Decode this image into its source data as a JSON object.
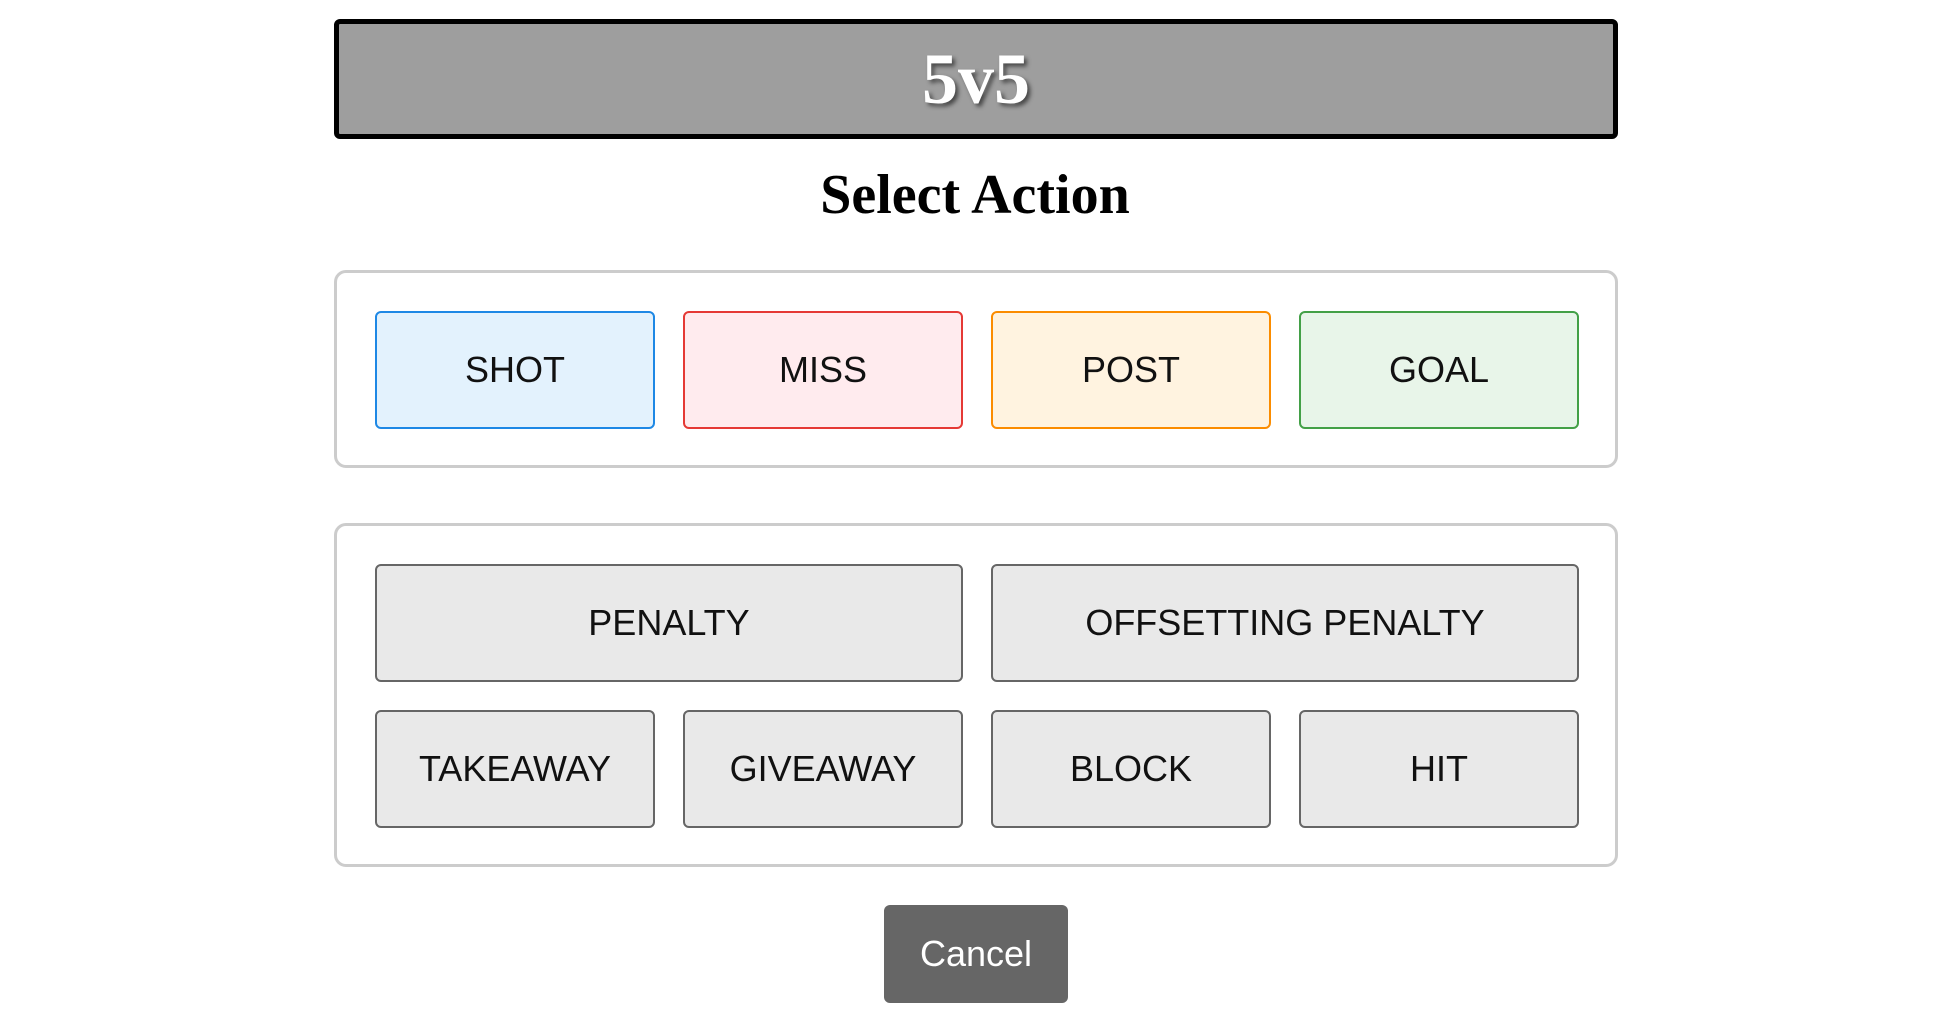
{
  "header": {
    "strength": "5v5",
    "title": "Select Action"
  },
  "shot_actions": [
    {
      "label": "SHOT",
      "color": "#1e88e5"
    },
    {
      "label": "MISS",
      "color": "#e53935"
    },
    {
      "label": "POST",
      "color": "#fb8c00"
    },
    {
      "label": "GOAL",
      "color": "#43a047"
    }
  ],
  "event_actions": {
    "row1": [
      {
        "label": "PENALTY"
      },
      {
        "label": "OFFSETTING PENALTY"
      }
    ],
    "row2": [
      {
        "label": "TAKEAWAY"
      },
      {
        "label": "GIVEAWAY"
      },
      {
        "label": "BLOCK"
      },
      {
        "label": "HIT"
      }
    ]
  },
  "footer": {
    "cancel_label": "Cancel"
  }
}
